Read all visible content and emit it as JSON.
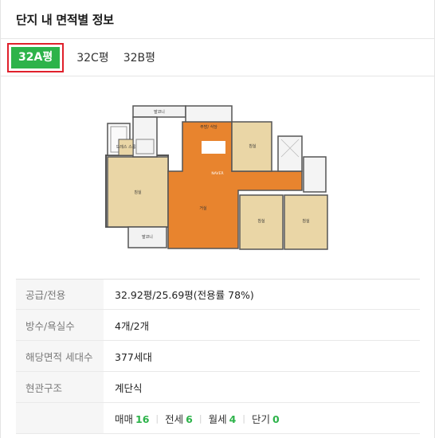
{
  "header": {
    "title": "단지 내 면적별 정보"
  },
  "tabs": [
    {
      "label": "32A평",
      "active": true
    },
    {
      "label": "32C평",
      "active": false
    },
    {
      "label": "32B평",
      "active": false
    }
  ],
  "floorplan": {
    "rooms": {
      "balcony_top": "발코니",
      "kitchen": "주방/\n식당",
      "room_top_right": "침실",
      "dress": "드레스\n스룸",
      "room_left": "침실",
      "living": "거실",
      "room_mid": "침실",
      "room_right": "침실",
      "balcony_bottom": "발코니"
    },
    "watermark": "NAVER"
  },
  "info": {
    "rows": [
      {
        "label": "공급/전용",
        "value": "32.92평/25.69평(전용률 78%)"
      },
      {
        "label": "방수/욕실수",
        "value": "4개/2개"
      },
      {
        "label": "해당면적 세대수",
        "value": "377세대"
      },
      {
        "label": "현관구조",
        "value": "계단식"
      }
    ],
    "trades": [
      {
        "label": "매매",
        "count": "16"
      },
      {
        "label": "전세",
        "count": "6"
      },
      {
        "label": "월세",
        "count": "4"
      },
      {
        "label": "단기",
        "count": "0"
      }
    ]
  },
  "colors": {
    "accent": "#2db34a",
    "highlight": "#e0202b",
    "floor_wood": "#e8842e",
    "floor_room": "#ead6a6"
  }
}
